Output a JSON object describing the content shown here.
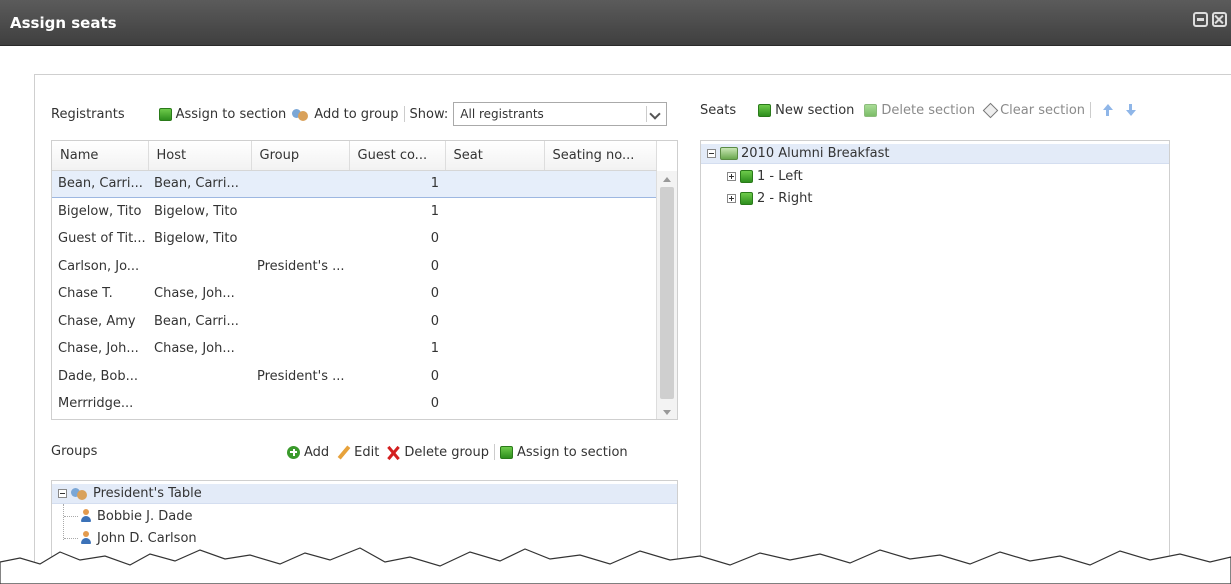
{
  "window": {
    "title": "Assign seats"
  },
  "registrants": {
    "label": "Registrants",
    "assign_to_section": "Assign to section",
    "add_to_group": "Add to group",
    "show_label": "Show:",
    "show_value": "All registrants",
    "columns": [
      "Name",
      "Host",
      "Group",
      "Guest co...",
      "Seat",
      "Seating no..."
    ],
    "rows": [
      [
        "Bean, Carri...",
        "Bean, Carri...",
        "",
        "1",
        "",
        ""
      ],
      [
        "Bigelow, Tito",
        "Bigelow, Tito",
        "",
        "1",
        "",
        ""
      ],
      [
        "Guest of Tit...",
        "Bigelow, Tito",
        "",
        "0",
        "",
        ""
      ],
      [
        "Carlson, Jo...",
        "",
        "President's ...",
        "0",
        "",
        ""
      ],
      [
        "Chase T.",
        "Chase, Joh...",
        "",
        "0",
        "",
        ""
      ],
      [
        "Chase, Amy",
        "Bean, Carri...",
        "",
        "0",
        "",
        ""
      ],
      [
        "Chase, Joh...",
        "Chase, Joh...",
        "",
        "1",
        "",
        ""
      ],
      [
        "Dade, Bob...",
        "",
        "President's ...",
        "0",
        "",
        ""
      ],
      [
        "Merrridge...",
        "",
        "",
        "0",
        "",
        ""
      ]
    ]
  },
  "groups": {
    "label": "Groups",
    "add": "Add",
    "edit": "Edit",
    "delete_group": "Delete group",
    "assign_to_section": "Assign to section",
    "tree": {
      "root": "President's Table",
      "members": [
        "Bobbie J. Dade",
        "John D. Carlson"
      ]
    }
  },
  "seats": {
    "label": "Seats",
    "new_section": "New section",
    "delete_section": "Delete section",
    "clear_section": "Clear section",
    "tree": {
      "root": "2010 Alumni Breakfast",
      "sections": [
        "1 - Left",
        "2 - Right"
      ]
    }
  }
}
